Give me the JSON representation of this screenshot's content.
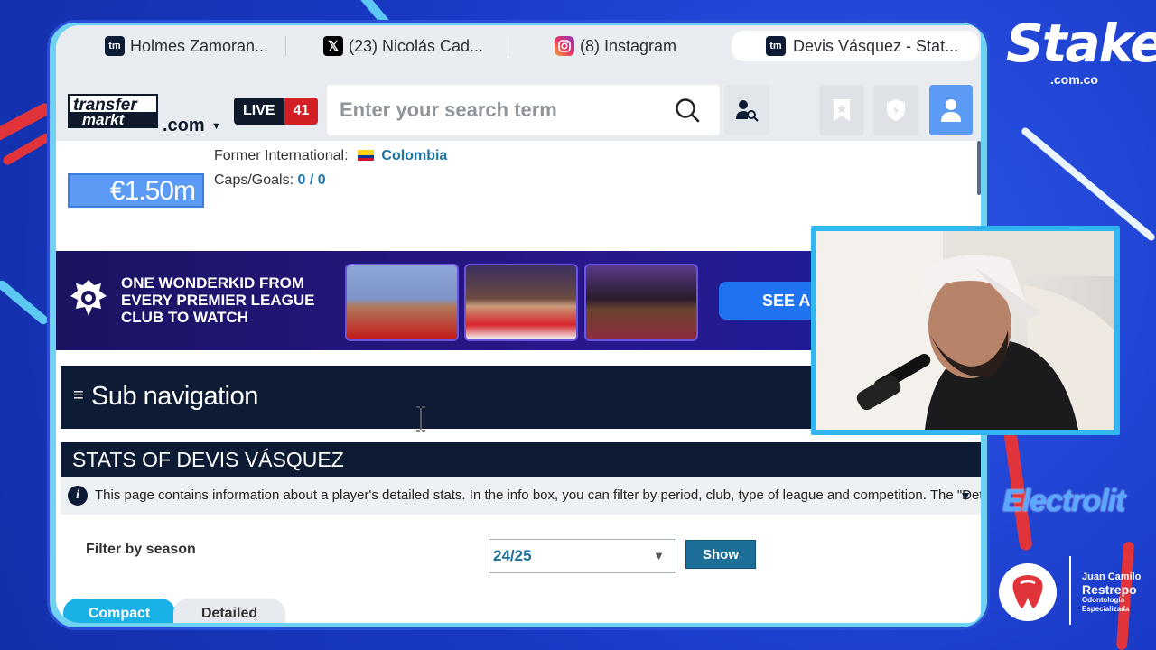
{
  "browser": {
    "tabs": [
      {
        "label": "Holmes Zamoran...",
        "icon": "transfermarkt-favicon-icon"
      },
      {
        "label": "(23) Nicolás Cad...",
        "icon": "x-favicon-icon"
      },
      {
        "label": "(8) Instagram",
        "icon": "instagram-favicon-icon"
      },
      {
        "label": "Devis Vásquez - Stat...",
        "icon": "transfermarkt-favicon-icon",
        "active": true
      }
    ]
  },
  "header": {
    "logo_top": "transfer",
    "logo_bottom": "markt",
    "logo_domain": ".com",
    "live_label": "LIVE",
    "live_count": "41",
    "search_placeholder": "Enter your search term"
  },
  "player": {
    "market_value": "€1.50m",
    "former_international_label": "Former International:",
    "former_international_value": "Colombia",
    "caps_goals_label": "Caps/Goals:",
    "caps": "0",
    "goals_sep": " / ",
    "goals": "0"
  },
  "banner": {
    "text": "ONE WONDERKID FROM EVERY PREMIER LEAGUE CLUB TO WATCH",
    "cta": "SEE AL"
  },
  "subnav": {
    "label": "Sub navigation"
  },
  "stats": {
    "title": "STATS OF DEVIS VÁSQUEZ",
    "notice": "This page contains information about a player's detailed stats. In the info box, you can filter by period, club, type of league and competition. The \"Detaile...",
    "filter_label": "Filter by season",
    "season_value": "24/25",
    "show_button": "Show",
    "tab_compact": "Compact",
    "tab_detailed": "Detailed"
  },
  "overlay": {
    "brand": "Stake",
    "brand_domain": ".com.co",
    "sponsor": "Electrolit",
    "sponsor2_line1": "Juan Camilo",
    "sponsor2_line2": "Restrepo",
    "sponsor2_line3": "Odontología",
    "sponsor2_line4": "Especializada"
  },
  "colors": {
    "tm_navy": "#0e1b34",
    "tm_blue": "#1d6f9a",
    "compact_tab": "#19b1e6",
    "live_red": "#d21f26"
  }
}
